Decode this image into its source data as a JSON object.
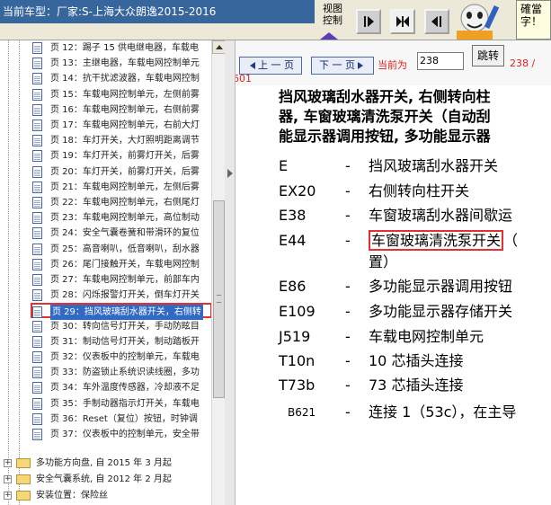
{
  "header": {
    "car_model": "当前车型：厂家:S-上海大众朗逸2015-2016",
    "view_control": "视图控制",
    "hint_text": "確當字！"
  },
  "sidebar": {
    "pages": [
      "页 12：踢子 15 供电继电器，车载电",
      "页 13：主继电器，车载电网控制单元",
      "页 14：抗干扰滤波器，车载电网控制",
      "页 15：车载电网控制单元，左侧前雾",
      "页 16：车载电网控制单元，右侧前雾",
      "页 17：车载电网控制单元，右前大灯",
      "页 18：车灯开关，大灯照明距离调节",
      "页 19：车灯开关，前雾灯开关，后雾",
      "页 20：车灯开关，前雾灯开关，后雾",
      "页 21：车载电网控制单元，左侧后雾",
      "页 22：车载电网控制单元，右侧尾灯",
      "页 23：车载电网控制单元，高位制动",
      "页 24：安全气囊卷簧和带滑环的复位",
      "页 25：高音喇叭，低音喇叭，刮水器",
      "页 26：尾门接触开关，车载电网控制",
      "页 27：车载电网控制单元，前部车内",
      "页 28：闪烁报警灯开关，倒车灯开关",
      "页 29：挡风玻璃刮水器开关，右侧转",
      "页 30：转向信号灯开关，手动防眩目",
      "页 31：制动信号灯开关，制动踏板开",
      "页 32：仪表板中的控制单元，车载电",
      "页 33：防盗锁止系统识读线圈，多功",
      "页 34：车外温度传感器，冷却液不足",
      "页 35：手制动器指示灯开关，车载电",
      "页 36：Reset（复位）按钮，时钟调",
      "页 37：仪表板中的控制单元，安全带"
    ],
    "selected_index": 17,
    "folders": [
      "多功能方向盘, 自 2015 年 3 月起",
      "安全气囊系统, 自 2012 年 2 月起",
      "安装位置：保险丝"
    ]
  },
  "nav": {
    "prev_label": "上 一 页",
    "next_label": "下 一 页",
    "current_label": "当前为",
    "page_value": "238",
    "jump_label": "跳转",
    "total_a": "238 /",
    "total_b": "601"
  },
  "content": {
    "heading_lines": [
      "挡风玻璃刮水器开关, 右侧转向柱",
      "器, 车窗玻璃清洗泵开关（自动刮",
      "能显示器调用按钮, 多功能显示器"
    ],
    "legend": [
      {
        "code": "E",
        "dash": "-",
        "desc": "挡风玻璃刮水器开关"
      },
      {
        "code": "EX20",
        "dash": "-",
        "desc": "右侧转向柱开关"
      },
      {
        "code": "E38",
        "dash": "-",
        "desc": "车窗玻璃刮水器间歇运"
      },
      {
        "code": "E44",
        "dash": "-",
        "desc": "车窗玻璃清洗泵开关",
        "desc_tail": "（",
        "desc2": "置）"
      },
      {
        "code": "E86",
        "dash": "-",
        "desc": "多功能显示器调用按钮"
      },
      {
        "code": "E109",
        "dash": "-",
        "desc": "多功能显示器存储开关"
      },
      {
        "code": "J519",
        "dash": "-",
        "desc": "车载电网控制单元"
      },
      {
        "code": "T10n",
        "dash": "-",
        "desc": "10 芯插头连接"
      },
      {
        "code": "T73b",
        "dash": "-",
        "desc": "73 芯插头连接"
      },
      {
        "code": "B621",
        "dash": "-",
        "desc": "连接 1（53c），在主导"
      }
    ]
  }
}
